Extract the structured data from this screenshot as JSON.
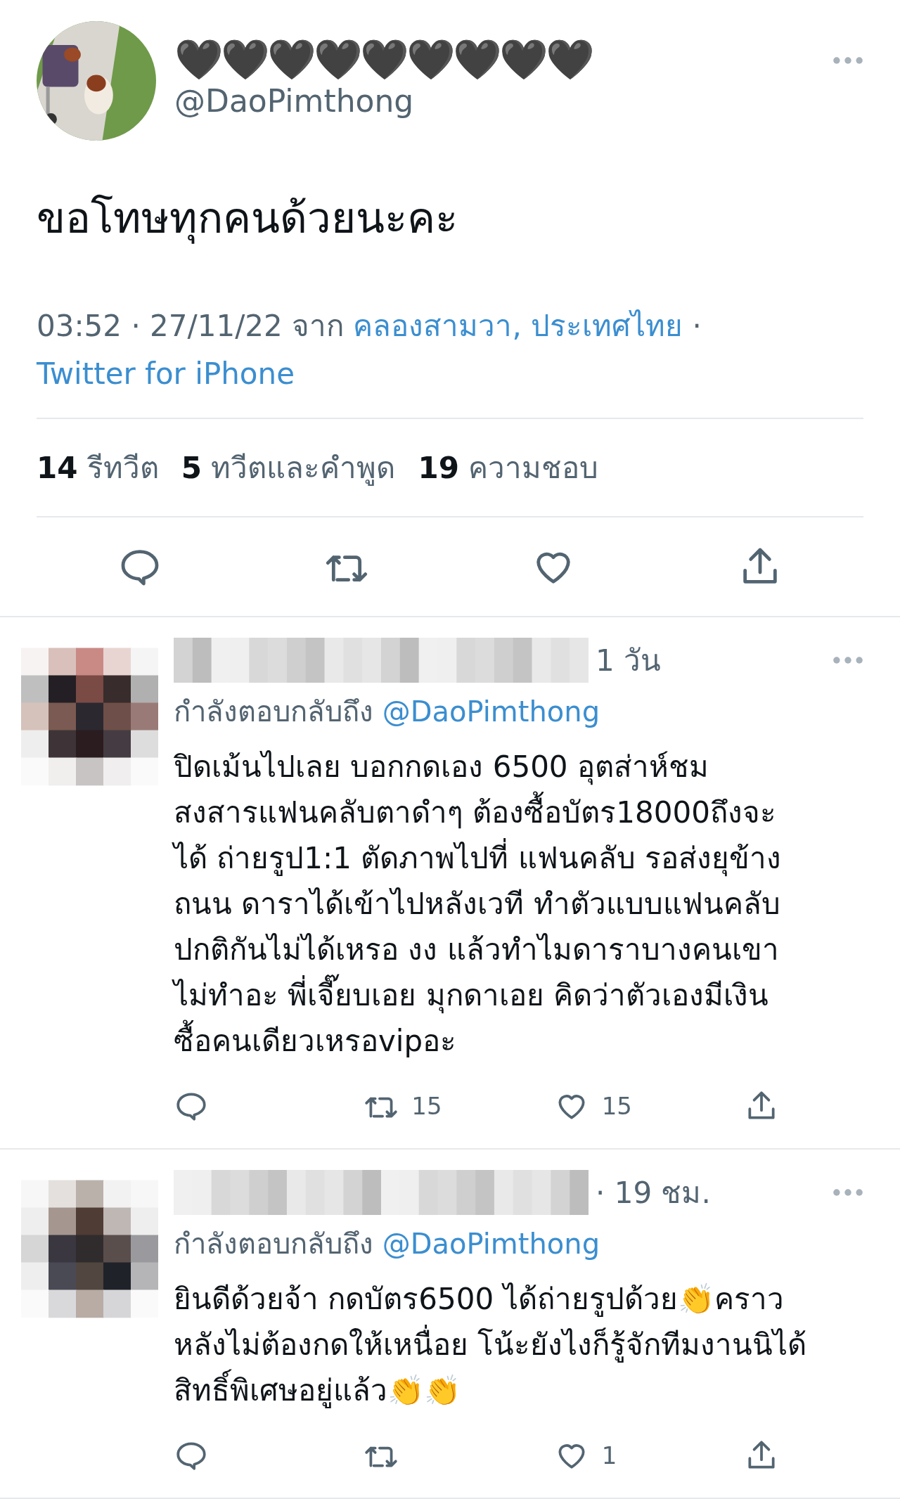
{
  "tweet": {
    "display_name": "🖤🖤🖤🖤🖤🖤🖤🖤🖤",
    "handle": "@DaoPimthong",
    "text": "ขอโทษทุกคนด้วยนะคะ",
    "time": "03:52 · 27/11/22",
    "from": "จาก",
    "location": "คลองสามวา, ประเทศไทย",
    "separator": "·",
    "source": "Twitter for iPhone",
    "stats": [
      {
        "count": "14",
        "label": "รีทวีต"
      },
      {
        "count": "5",
        "label": "ทวีตและคำพูด"
      },
      {
        "count": "19",
        "label": "ความชอบ"
      }
    ]
  },
  "replies": [
    {
      "time": "1 วัน",
      "replying_to": "กำลังตอบกลับถึง",
      "mention": "@DaoPimthong",
      "text": "ปิดเม้นไปเลย  บอกกดเอง 6500 อุตส่าห์ชม\nสงสารแฟนคลับตาดำๆ ต้องซื้อบัตร18000ถึงจะ\nได้ ถ่ายรูป1:1 ตัดภาพไปที่  แฟนคลับ รอส่งยุข้าง\nถนน ดาราได้เข้าไปหลังเวที ทำตัวแบบแฟนคลับ\nปกติกันไม่ได้เหรอ  งง แล้วทำไมดาราบางคนเขา\nไม่ทำอะ พี่เจี๊ยบเอย มุกดาเอย คิดว่าตัวเองมีเงิน\nซื้อคนเดียวเหรอvipอะ",
      "retweets": "15",
      "likes": "15"
    },
    {
      "time": "· 19 ชม.",
      "replying_to": "กำลังตอบกลับถึง",
      "mention": "@DaoPimthong",
      "text": "ยินดีด้วยจ้า กดบัตร6500 ได้ถ่ายรูปด้วย👏คราว\nหลังไม่ต้องกดให้เหนื่อย โน้ะยังไงก็รู้จักทีมงานนิได้\nสิทธิ์พิเศษอยู่แล้ว👏👏",
      "likes": "1"
    }
  ]
}
